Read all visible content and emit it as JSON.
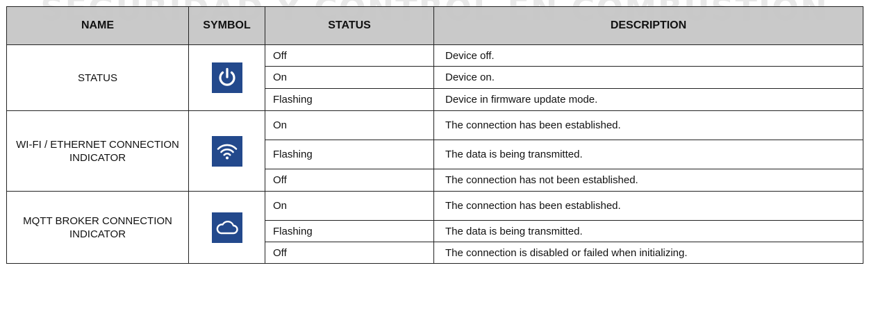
{
  "watermark": "SEGURIDAD Y CONTROL EN COMBUSTIÓN",
  "headers": {
    "name": "NAME",
    "symbol": "SYMBOL",
    "status": "STATUS",
    "description": "DESCRIPTION"
  },
  "colors": {
    "header_bg": "#c4c4c4",
    "icon_bg": "#23498c",
    "icon_fg": "#ffffff"
  },
  "groups": [
    {
      "name": "STATUS",
      "icon": "power-icon",
      "rows": [
        {
          "status": "Off",
          "description": "Device off."
        },
        {
          "status": "On",
          "description": "Device on."
        },
        {
          "status": "Flashing",
          "description": "Device in firmware update mode."
        }
      ]
    },
    {
      "name": "WI-FI / ETHERNET CONNECTION INDICATOR",
      "icon": "wifi-icon",
      "rows": [
        {
          "status": "On",
          "description": "The connection has been established."
        },
        {
          "status": "Flashing",
          "description": "The data is being transmitted."
        },
        {
          "status": "Off",
          "description": "The connection has not been established."
        }
      ]
    },
    {
      "name": "MQTT BROKER CONNECTION INDICATOR",
      "icon": "cloud-icon",
      "rows": [
        {
          "status": "On",
          "description": "The connection has been established."
        },
        {
          "status": "Flashing",
          "description": "The data is being transmitted."
        },
        {
          "status": "Off",
          "description": "The connection is disabled or failed when initializing."
        }
      ]
    }
  ]
}
